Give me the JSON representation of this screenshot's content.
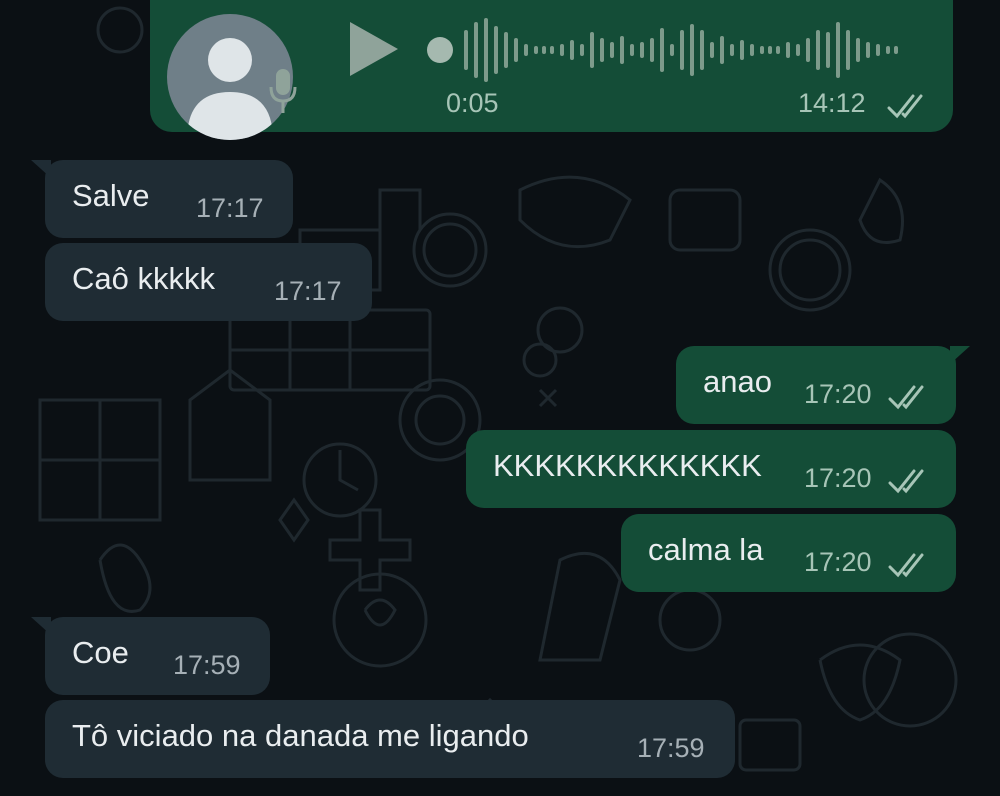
{
  "theme": {
    "background": "#0b1014",
    "incoming_bubble": "#1f2c34",
    "outgoing_bubble": "#144d37",
    "read_ticks": "#a7c5b7"
  },
  "voice_note": {
    "duration": "0:05",
    "time": "14:12",
    "icons": [
      "avatar-placeholder-icon",
      "microphone-icon",
      "play-icon",
      "double-check-icon"
    ]
  },
  "messages": [
    {
      "direction": "incoming",
      "text": "Salve",
      "time": "17:17"
    },
    {
      "direction": "incoming",
      "text": "Caô kkkkk",
      "time": "17:17"
    },
    {
      "direction": "outgoing",
      "text": "anao",
      "time": "17:20",
      "status": "read"
    },
    {
      "direction": "outgoing",
      "text": "KKKKKKKKKKKKK",
      "time": "17:20",
      "status": "read"
    },
    {
      "direction": "outgoing",
      "text": "calma la",
      "time": "17:20",
      "status": "read"
    },
    {
      "direction": "incoming",
      "text": "Coe",
      "time": "17:59"
    },
    {
      "direction": "incoming",
      "text": "Tô viciado na danada me ligando",
      "time": "17:59"
    }
  ]
}
